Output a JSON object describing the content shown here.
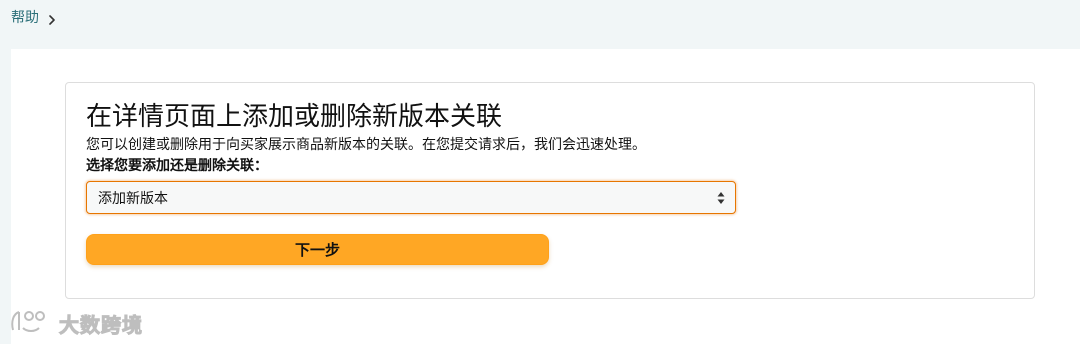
{
  "breadcrumb": {
    "items": [
      {
        "label": "帮助"
      }
    ],
    "separator_icon": "chevron-right-icon"
  },
  "card": {
    "title": "在详情页面上添加或删除新版本关联",
    "description": "您可以创建或删除用于向买家展示商品新版本的关联。在您提交请求后，我们会迅速处理。",
    "select_label": "选择您要添加还是删除关联：",
    "select": {
      "selected_value": "添加新版本",
      "icon": "sort-arrows-icon"
    },
    "next_button_label": "下一步"
  },
  "watermark": {
    "text": "大数跨境",
    "logo_icon": "brand-logo-icon"
  },
  "colors": {
    "page_background": "#f1f6f7",
    "link": "#2b6f79",
    "focus_border": "#e77600",
    "primary_button": "#ffa724"
  }
}
